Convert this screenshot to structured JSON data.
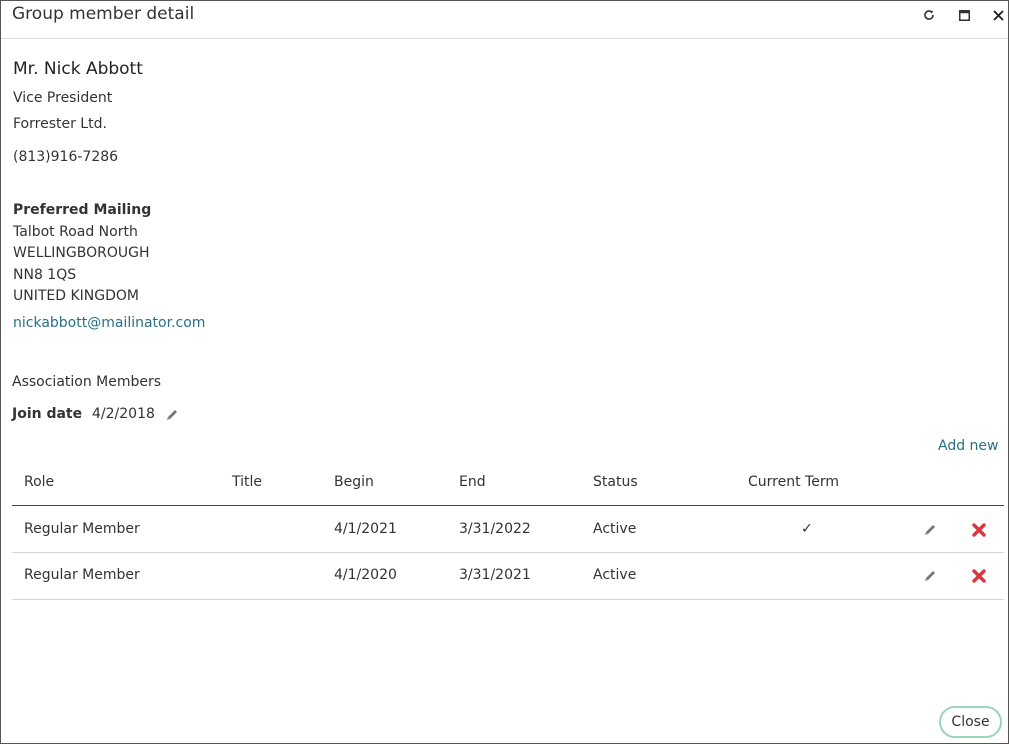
{
  "dialog": {
    "title": "Group member detail",
    "icons": [
      "refresh-icon",
      "maximize-icon",
      "close-icon"
    ]
  },
  "contact": {
    "name": "Mr. Nick Abbott",
    "job_title": "Vice President",
    "company": "Forrester Ltd.",
    "phone": "(813)916-7286"
  },
  "mailing": {
    "heading": "Preferred Mailing",
    "line1": "Talbot Road North",
    "line2": "WELLINGBOROUGH",
    "line3": "NN8 1QS",
    "line4": "UNITED KINGDOM",
    "email": "nickabbott@mailinator.com"
  },
  "association": {
    "heading": "Association Members",
    "join_label": "Join date",
    "join_date": "4/2/2018",
    "add_new": "Add new"
  },
  "table": {
    "columns": [
      "Role",
      "Title",
      "Begin",
      "End",
      "Status",
      "Current Term"
    ],
    "rows": [
      {
        "role": "Regular Member",
        "title": "",
        "begin": "4/1/2021",
        "end": "3/31/2022",
        "status": "Active",
        "current": "✓"
      },
      {
        "role": "Regular Member",
        "title": "",
        "begin": "4/1/2020",
        "end": "3/31/2021",
        "status": "Active",
        "current": ""
      }
    ]
  },
  "footer": {
    "close_label": "Close"
  },
  "colors": {
    "link": "#2a6f85",
    "delete": "#d9363e",
    "close_border": "#9ad6b8"
  }
}
